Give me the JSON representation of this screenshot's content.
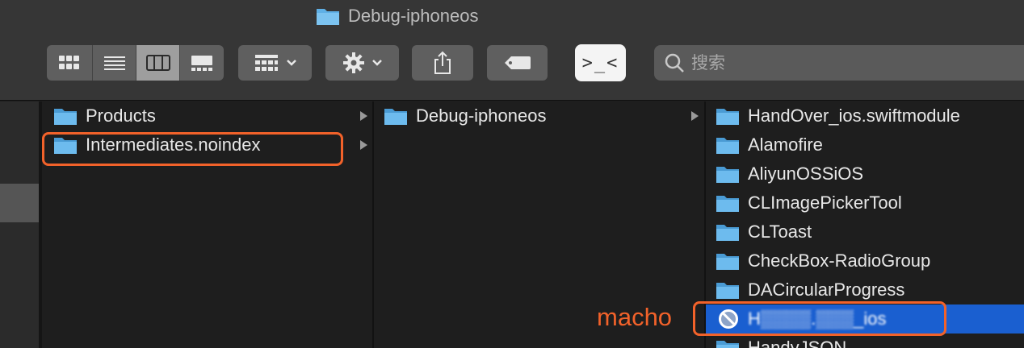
{
  "window": {
    "title": "Debug-iphoneos"
  },
  "toolbar": {
    "view_modes": [
      "icon-view",
      "list-view",
      "column-view",
      "gallery-view"
    ],
    "active_view": "column-view",
    "search_placeholder": "搜索"
  },
  "columns": [
    {
      "items": [
        {
          "label": "Products",
          "has_children": true
        },
        {
          "label": "Intermediates.noindex",
          "has_children": true
        }
      ]
    },
    {
      "items": [
        {
          "label": "Debug-iphoneos",
          "has_children": true
        }
      ]
    },
    {
      "items": [
        {
          "label": "HandOver_ios.swiftmodule"
        },
        {
          "label": "Alamofire"
        },
        {
          "label": "AliyunOSSiOS"
        },
        {
          "label": "CLImagePickerTool"
        },
        {
          "label": "CLToast"
        },
        {
          "label": "CheckBox-RadioGroup"
        },
        {
          "label": "DACircularProgress"
        },
        {
          "label": "H▒▒▒▒.▒▒▒_ios",
          "selected": true,
          "icon": "prohibited-icon"
        },
        {
          "label": "HandyJSON"
        }
      ]
    }
  ],
  "annotation": {
    "text": "macho"
  },
  "colors": {
    "highlight": "#f2622a",
    "selection": "#1a5fd0",
    "folder": "#5fb0e6"
  }
}
